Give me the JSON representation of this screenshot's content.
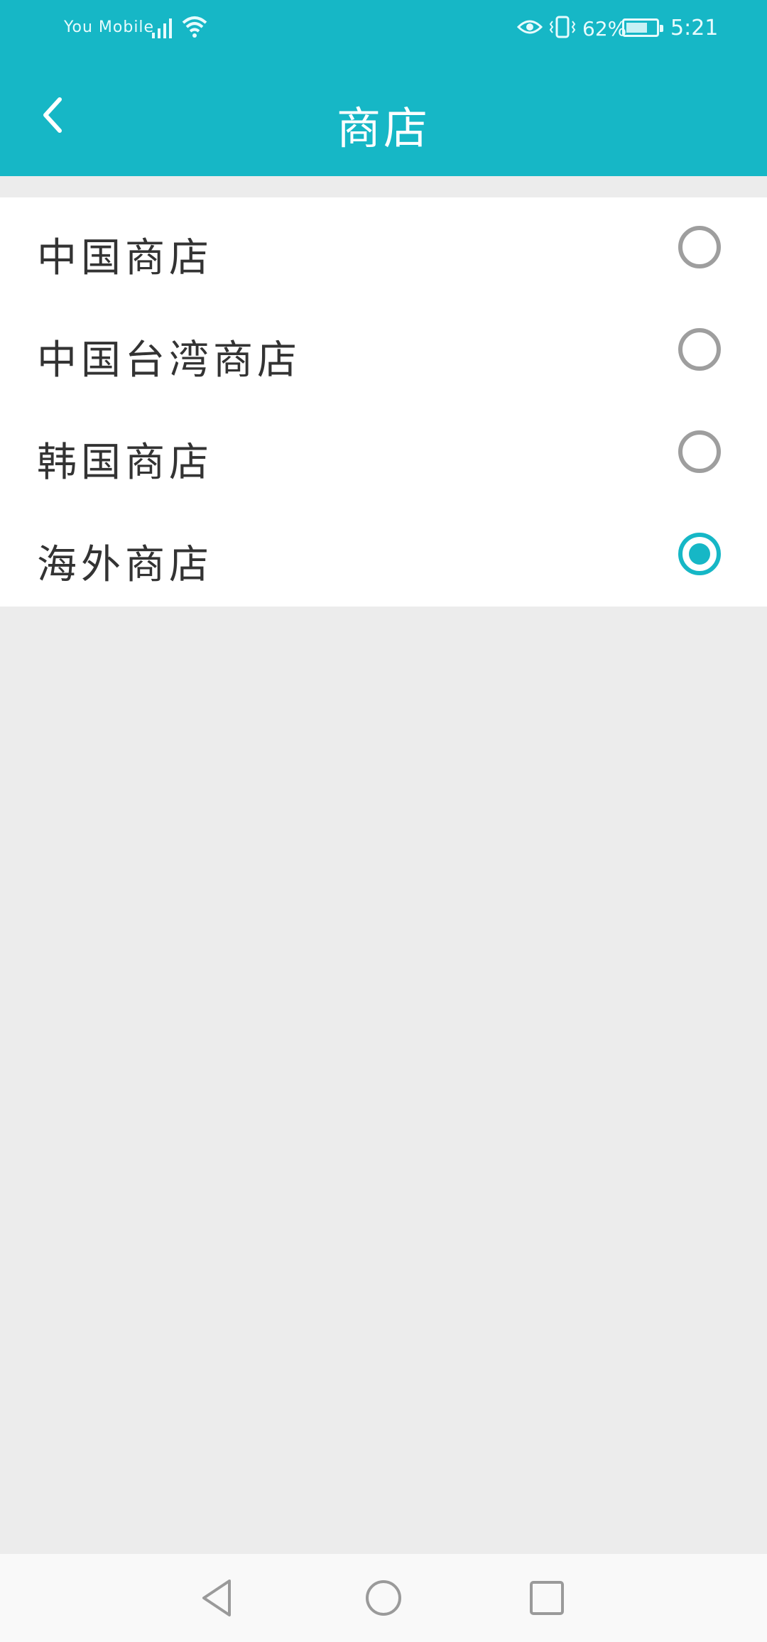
{
  "status_bar": {
    "carrier": "You Mobile",
    "battery_percent": "62%",
    "time": "5:21",
    "icons": [
      "signal-icon",
      "wifi-icon",
      "eye-icon",
      "vibrate-icon",
      "battery-icon"
    ]
  },
  "app_bar": {
    "title": "商店",
    "back_icon": "chevron-left-icon"
  },
  "stores": [
    {
      "label": "中国商店",
      "selected": false
    },
    {
      "label": "中国台湾商店",
      "selected": false
    },
    {
      "label": "韩国商店",
      "selected": false
    },
    {
      "label": "海外商店",
      "selected": true
    }
  ],
  "nav_bar": {
    "icons": [
      "back-triangle-icon",
      "home-circle-icon",
      "recent-square-icon"
    ]
  },
  "colors": {
    "accent": "#16b7c6",
    "radio_off": "#9e9e9e",
    "background": "#ececec"
  }
}
